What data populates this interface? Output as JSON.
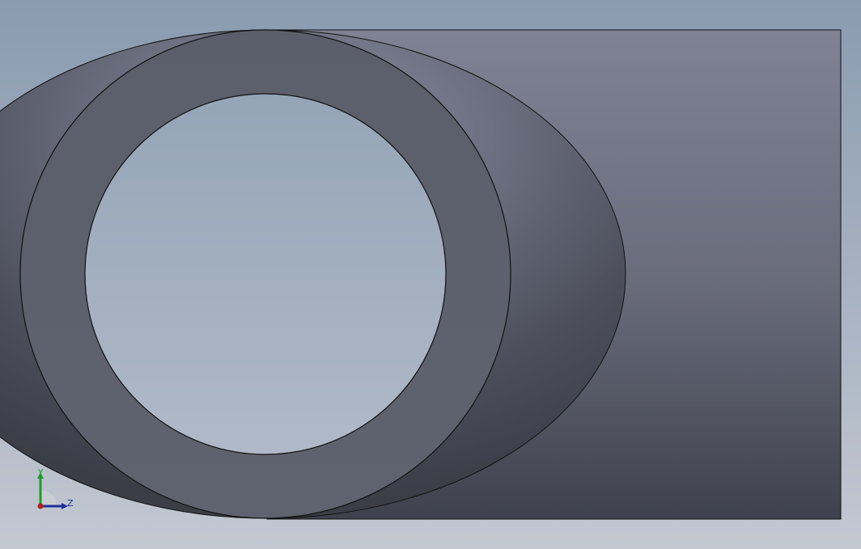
{
  "viewport": {
    "background_top": "#8a9bb0",
    "background_bottom": "#c3c8d1"
  },
  "model": {
    "part": "tube-end-view",
    "body_color_top": "#7e8293",
    "body_color_bottom": "#3f424d",
    "ring_color": "#5f636f",
    "edge_color": "#111111"
  },
  "triad": {
    "y_label": "Y",
    "z_label": "Z",
    "y_color": "#1f9a2c",
    "z_color": "#1c2f9a",
    "origin_color": "#b52020"
  }
}
